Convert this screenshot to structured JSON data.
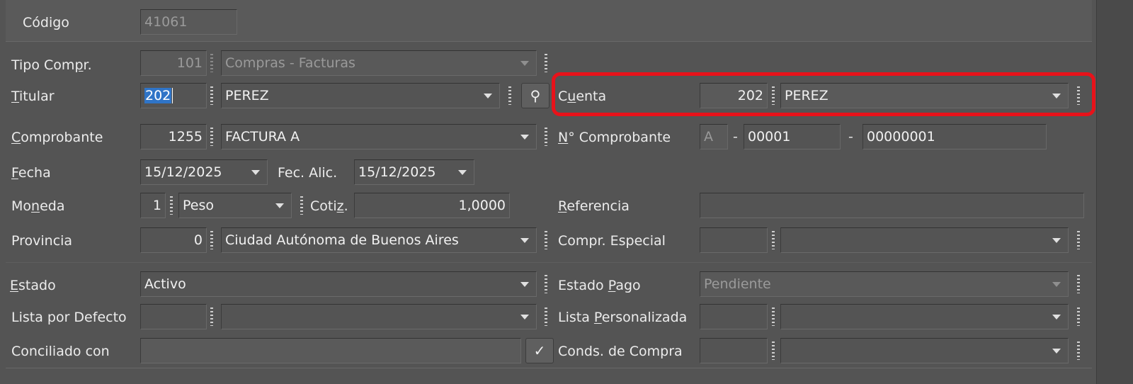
{
  "codigo": {
    "label": "Código",
    "value": "41061"
  },
  "tipo_compr": {
    "label_pre": "Tipo Com",
    "label_u": "p",
    "label_post": "r.",
    "code": "101",
    "name": "Compras - Facturas"
  },
  "titular": {
    "label_u": "T",
    "label_post": "itular",
    "code": "202",
    "name": "PEREZ"
  },
  "cuenta": {
    "label_pre": "C",
    "label_u": "u",
    "label_post": "enta",
    "code": "202",
    "name": "PEREZ"
  },
  "comprobante": {
    "label_u": "C",
    "label_post": "omprobante",
    "code": "1255",
    "name": "FACTURA A"
  },
  "nro_comprobante": {
    "label_u": "N",
    "label_post": "° Comprobante",
    "letter": "A",
    "dash1": "-",
    "punto": "00001",
    "dash2": "-",
    "numero": "00000001"
  },
  "fecha": {
    "label_u": "F",
    "label_post": "echa",
    "value": "15/12/2025"
  },
  "fec_alic": {
    "label": "Fec. Alic.",
    "value": "15/12/2025"
  },
  "moneda": {
    "label_pre": "Mo",
    "label_u": "n",
    "label_post": "eda",
    "code": "1",
    "name": "Peso"
  },
  "cotiz": {
    "label_pre": "Coti",
    "label_u": "z",
    "label_post": ".",
    "value": "1,0000"
  },
  "referencia": {
    "label_u": "R",
    "label_post": "eferencia",
    "value": ""
  },
  "provincia": {
    "label": "Provincia",
    "code": "0",
    "name": "Ciudad Autónoma de Buenos Aires"
  },
  "compr_especial": {
    "label": "Compr. Especial",
    "code": "",
    "name": ""
  },
  "estado": {
    "label_u": "E",
    "label_post": "stado",
    "value": "Activo"
  },
  "estado_pago": {
    "label_pre": "Estado ",
    "label_u": "P",
    "label_post": "ago",
    "value": "Pendiente"
  },
  "lista_defecto": {
    "label": "Lista por Defecto",
    "code": "",
    "name": ""
  },
  "lista_personalizada": {
    "label_pre": "Lista ",
    "label_u": "P",
    "label_post": "ersonalizada",
    "code": "",
    "name": ""
  },
  "conciliado": {
    "label": "Conciliado con",
    "value": "",
    "button_glyph": "✓"
  },
  "conds_compra": {
    "label": "Conds. de Compra",
    "code": "",
    "name": ""
  },
  "colors": {
    "highlight": "#e8121a",
    "selection": "#2f74c7",
    "background": "#545454"
  }
}
